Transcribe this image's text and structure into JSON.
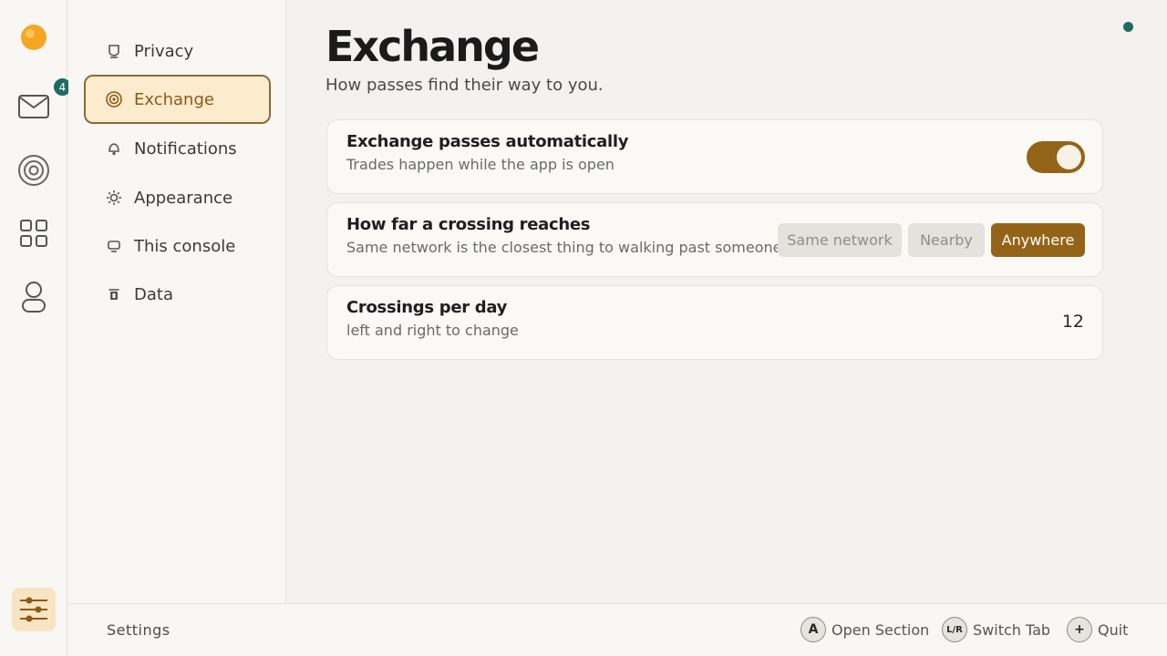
{
  "rail": {
    "mail_badge": "4"
  },
  "nav": {
    "items": [
      {
        "label": "Privacy",
        "icon": "shield-icon"
      },
      {
        "label": "Exchange",
        "icon": "target-icon"
      },
      {
        "label": "Notifications",
        "icon": "bell-icon"
      },
      {
        "label": "Appearance",
        "icon": "sun-icon"
      },
      {
        "label": "This console",
        "icon": "monitor-icon"
      },
      {
        "label": "Data",
        "icon": "trash-icon"
      }
    ],
    "active_index": 1
  },
  "page": {
    "title": "Exchange",
    "subtitle": "How passes find their way to you."
  },
  "settings": {
    "auto": {
      "title": "Exchange passes automatically",
      "desc": "Trades happen while the app is open",
      "enabled": true
    },
    "reach": {
      "title": "How far a crossing reaches",
      "desc": "Same network is the closest thing to walking past someone",
      "options": [
        "Same network",
        "Nearby",
        "Anywhere"
      ],
      "selected": "Anywhere"
    },
    "per_day": {
      "title": "Crossings per day",
      "desc": "left and right to change",
      "value": "12"
    }
  },
  "footer": {
    "label": "Settings",
    "hints": [
      {
        "key": "A",
        "label": "Open Section"
      },
      {
        "key": "L/R",
        "label": "Switch Tab"
      },
      {
        "key": "+",
        "label": "Quit"
      }
    ]
  },
  "colors": {
    "accent": "#936418",
    "accent_light": "#fcebcd",
    "teal": "#1f6b63",
    "sun": "#f5a623"
  }
}
